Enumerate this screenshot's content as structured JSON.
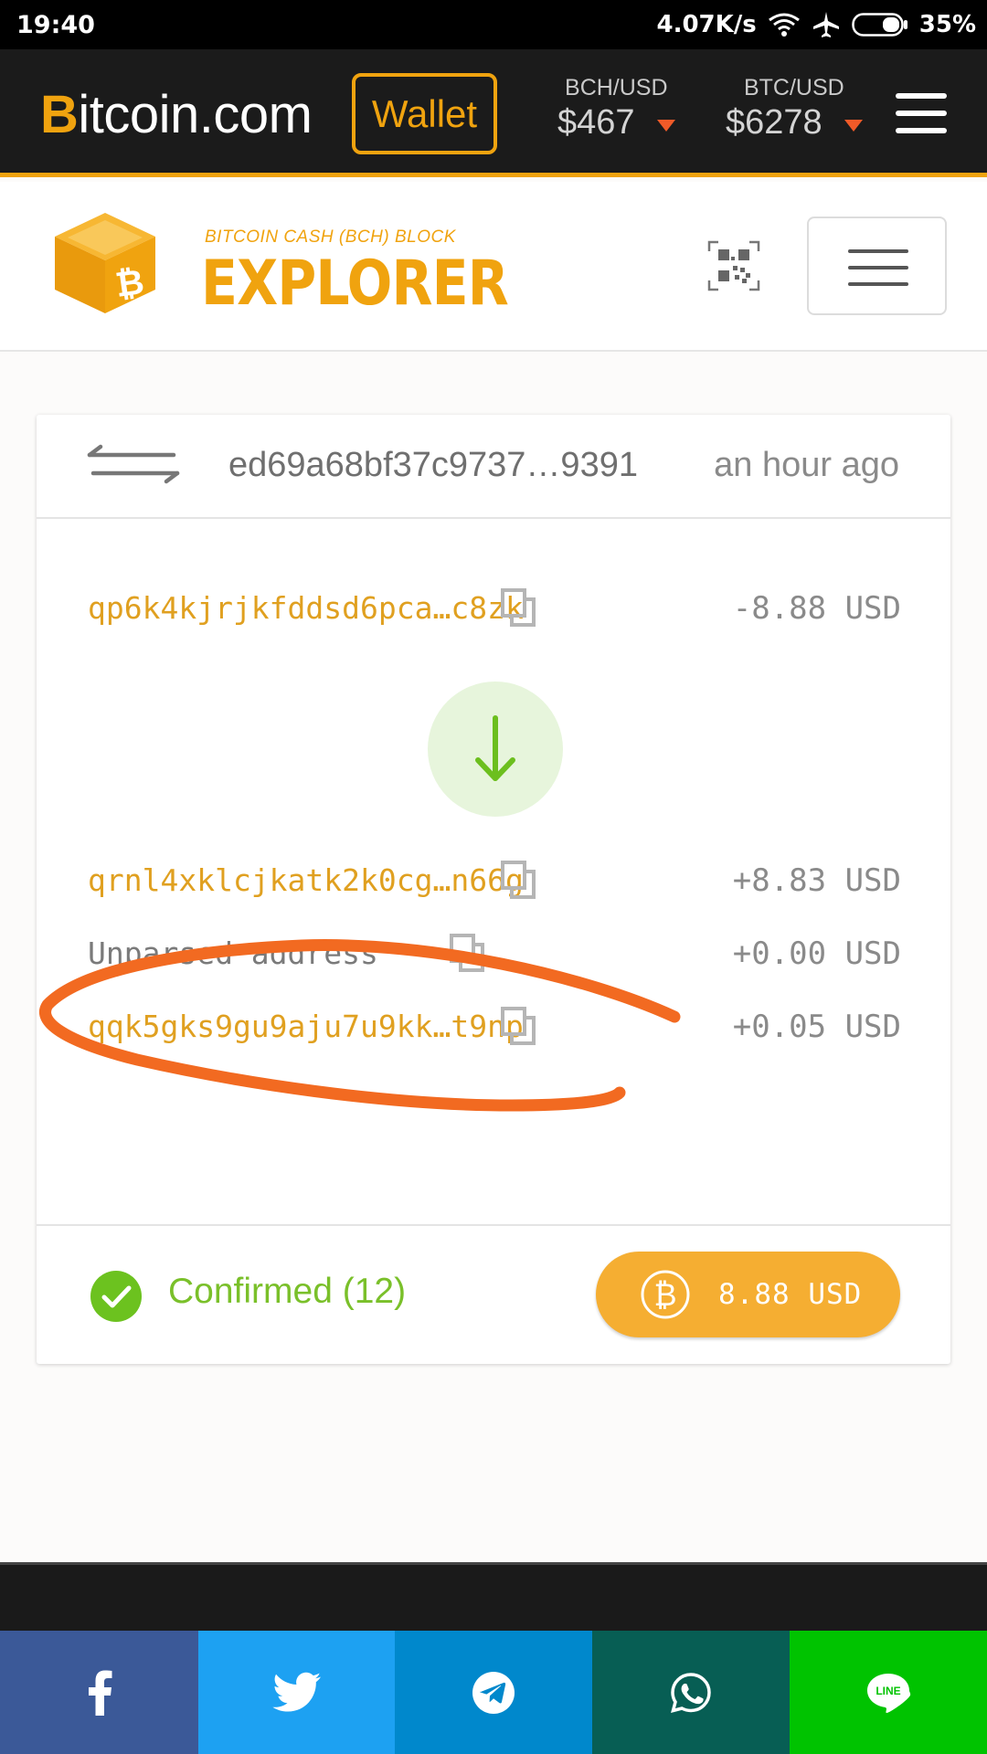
{
  "status_bar": {
    "time": "19:40",
    "network_speed": "4.07K/s",
    "battery": "35%"
  },
  "nav": {
    "logo_b": "B",
    "logo_rest": "itcoin.com",
    "wallet_label": "Wallet",
    "tickers": [
      {
        "label": "BCH/USD",
        "price": "$467"
      },
      {
        "label": "BTC/USD",
        "price": "$6278"
      }
    ]
  },
  "explorer": {
    "subtitle": "BITCOIN CASH (BCH) BLOCK",
    "title": "EXPLORER"
  },
  "transaction": {
    "hash": "ed69a68bf37c9737…9391",
    "time": "an hour ago",
    "inputs": [
      {
        "address": "qp6k4kjrjkfddsd6pca…c8zk",
        "amount": "-8.88 USD"
      }
    ],
    "outputs": [
      {
        "address": "qrnl4xklcjkatk2k0cg…n66g",
        "amount": "+8.83 USD"
      },
      {
        "address": "Unparsed address",
        "amount": "+0.00 USD"
      },
      {
        "address": "qqk5gks9gu9aju7u9kk…t9np",
        "amount": "+0.05 USD"
      }
    ],
    "status": "Confirmed (12)",
    "total": "8.88 USD"
  },
  "colors": {
    "brand": "#f0a30f",
    "confirmed": "#7ac02a",
    "annotation": "#f26a21"
  },
  "share": [
    "facebook-icon",
    "twitter-icon",
    "telegram-icon",
    "whatsapp-icon",
    "line-icon"
  ]
}
